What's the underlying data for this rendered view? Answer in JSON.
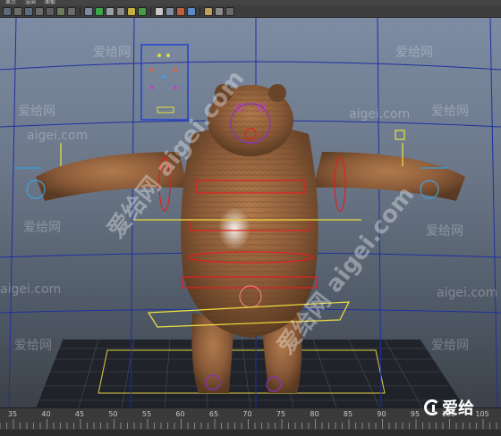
{
  "menubar": {
    "items": [
      "显示",
      "渲染",
      "面板"
    ]
  },
  "toolbar": {
    "buttons": [
      {
        "icon": "grid-icon",
        "color": "#5c6a7a"
      },
      {
        "icon": "frame-icon",
        "color": "#6b6b6b"
      },
      {
        "icon": "camera-icon",
        "color": "#5a6c80"
      },
      {
        "icon": "film-icon",
        "color": "#6a6a6a"
      },
      {
        "icon": "bookmark-icon",
        "color": "#5f5f5f"
      },
      {
        "icon": "image-plane-icon",
        "color": "#6a7a5a"
      },
      {
        "icon": "text-icon",
        "color": "#6c6c6c"
      },
      {
        "icon": "cube-icon",
        "color": "#7a8aa0"
      },
      {
        "icon": "wireframe-icon",
        "color": "#3aa84a"
      },
      {
        "icon": "smooth-shade-icon",
        "color": "#9aa0a8"
      },
      {
        "icon": "texture-icon",
        "color": "#8a8a8a"
      },
      {
        "icon": "light-icon",
        "color": "#c8b040"
      },
      {
        "icon": "shadow-icon",
        "color": "#4a9a4a"
      },
      {
        "icon": "sphere-icon",
        "color": "#c9c9c9"
      },
      {
        "icon": "ambient-occlusion-icon",
        "color": "#8090a0"
      },
      {
        "icon": "motion-blur-icon",
        "color": "#c06040"
      },
      {
        "icon": "antialias-icon",
        "color": "#5a8ac8"
      },
      {
        "icon": "isolate-icon",
        "color": "#c0a060"
      },
      {
        "icon": "xray-icon",
        "color": "#8a8a8a"
      },
      {
        "icon": "xray-joints-icon",
        "color": "#6a6a6a"
      }
    ]
  },
  "viewport": {
    "grid_color": "#1f2fa0",
    "mesh_color": "#8a5a38",
    "control_colors": [
      "#e02020",
      "#f0e040",
      "#8a30c0",
      "#30a0e0",
      "#40c040"
    ]
  },
  "watermarks": {
    "cn": "爱给网",
    "en": "aigei.com",
    "diagonal": "爱给网 aigei.com",
    "logo_text": "爱给"
  },
  "timeline": {
    "ticks": [
      "35",
      "40",
      "45",
      "50",
      "55",
      "60",
      "65",
      "70",
      "75",
      "80",
      "85",
      "90",
      "95",
      "100",
      "105"
    ]
  }
}
